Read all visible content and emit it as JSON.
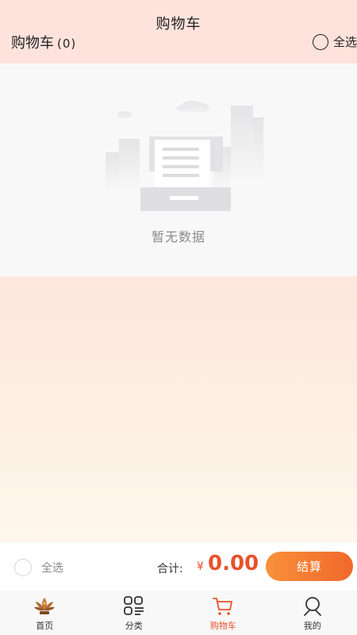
{
  "header": {
    "title": "购物车",
    "cart_label": "购物车",
    "cart_count": "(0)",
    "select_all": "全选"
  },
  "empty_state": {
    "message": "暂无数据"
  },
  "checkout": {
    "select_all": "全选",
    "total_label": "合计:",
    "currency": "¥",
    "total_amount": "0.00",
    "checkout_button": "结算"
  },
  "tab_bar": {
    "tabs": [
      {
        "label": "首页",
        "icon": "lotus-home-icon",
        "active": false
      },
      {
        "label": "分类",
        "icon": "category-grid-icon",
        "active": false
      },
      {
        "label": "购物车",
        "icon": "cart-icon",
        "active": true
      },
      {
        "label": "我的",
        "icon": "person-icon",
        "active": false
      }
    ]
  },
  "colors": {
    "accent": "#e8522a",
    "header_bg": "#fde3dc",
    "checkout_gradient_start": "#f8913a",
    "checkout_gradient_end": "#f0682b"
  }
}
